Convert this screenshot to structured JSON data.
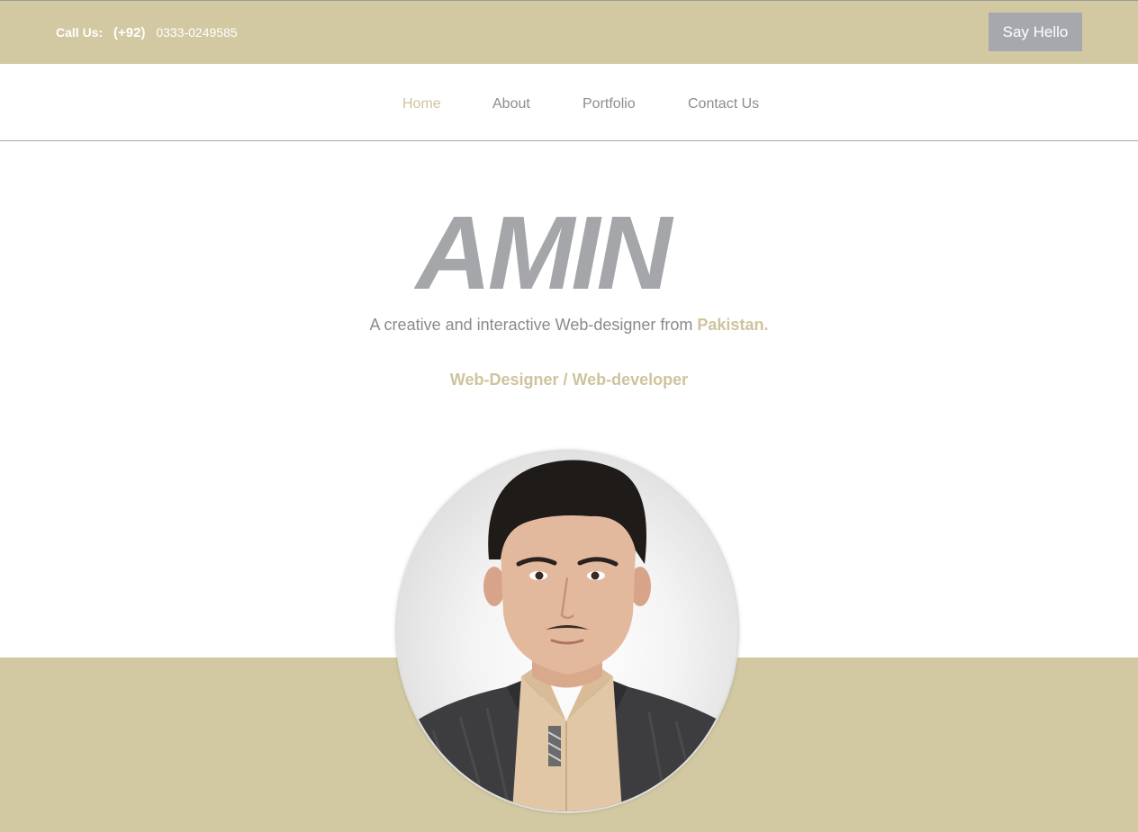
{
  "topbar": {
    "call_label": "Call Us:",
    "country_code": "(+92)",
    "phone": "0333-0249585",
    "say_hello_label": "Say Hello"
  },
  "nav": {
    "items": [
      {
        "label": "Home",
        "active": true
      },
      {
        "label": "About",
        "active": false
      },
      {
        "label": "Portfolio",
        "active": false
      },
      {
        "label": "Contact Us",
        "active": false
      }
    ]
  },
  "hero": {
    "logo_text": "AMIN",
    "tagline_prefix": "A creative and interactive Web-designer from",
    "tagline_highlight": "Pakistan.",
    "role": "Web-Designer / Web-developer",
    "portrait_icon": "profile-photo"
  },
  "colors": {
    "accent": "#d2c9a2",
    "accent_text": "#cfc39d",
    "button_gray": "#a7a8ad",
    "text_gray": "#8d8d8d",
    "logo_gray": "#a5a6aa"
  }
}
